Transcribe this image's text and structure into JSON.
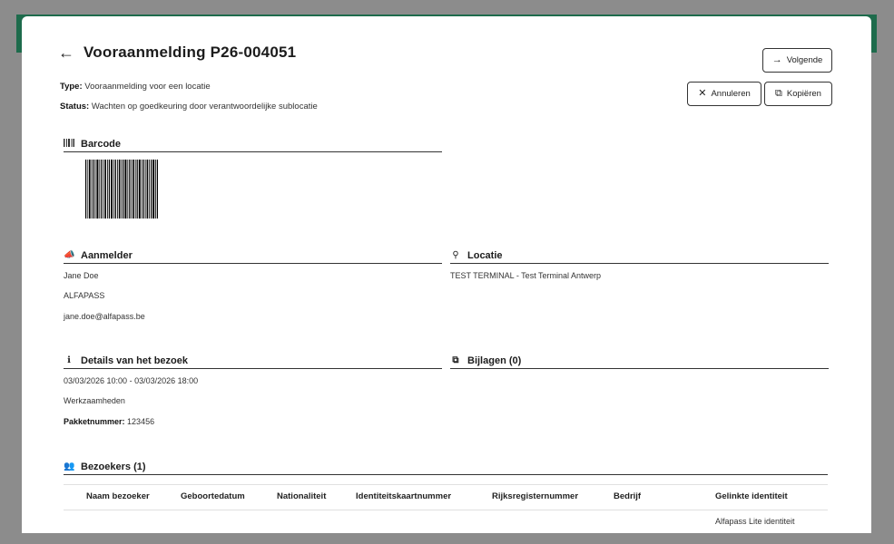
{
  "header": {
    "back_icon": "arrow-left-icon",
    "title": "Vooraanmelding P26-004051"
  },
  "meta": {
    "type_label": "Type:",
    "type_value": "Vooraanmelding voor een locatie",
    "status_label": "Status:",
    "status_value": "Wachten op goedkeuring door verantwoordelijke sublocatie"
  },
  "actions": {
    "next_label": "Volgende",
    "cancel_label": "Annuleren",
    "copy_label": "Kopiëren"
  },
  "barcode": {
    "heading": "Barcode"
  },
  "aanmelder": {
    "heading": "Aanmelder",
    "name": "Jane Doe",
    "company": "ALFAPASS",
    "email": "jane.doe@alfapass.be"
  },
  "locatie": {
    "heading": "Locatie",
    "value": "TEST TERMINAL - Test Terminal Antwerp"
  },
  "details": {
    "heading": "Details van het bezoek",
    "period": "03/03/2026 10:00 - 03/03/2026 18:00",
    "purpose": "Werkzaamheden",
    "package_label": "Pakketnummer:",
    "package_value": "123456"
  },
  "bijlagen": {
    "heading": "Bijlagen (0)"
  },
  "bezoekers": {
    "heading": "Bezoekers (1)",
    "columns": [
      "Naam bezoeker",
      "Geboortedatum",
      "Nationaliteit",
      "Identiteitskaartnummer",
      "Rijksregisternummer",
      "Bedrijf",
      "Gelinkte identiteit"
    ],
    "rows": [
      {
        "linked_identity": "Alfapass Lite identiteit"
      }
    ]
  },
  "colors": {
    "brand_green": "#1e6b4c",
    "overlay": "#8c8c8c"
  }
}
